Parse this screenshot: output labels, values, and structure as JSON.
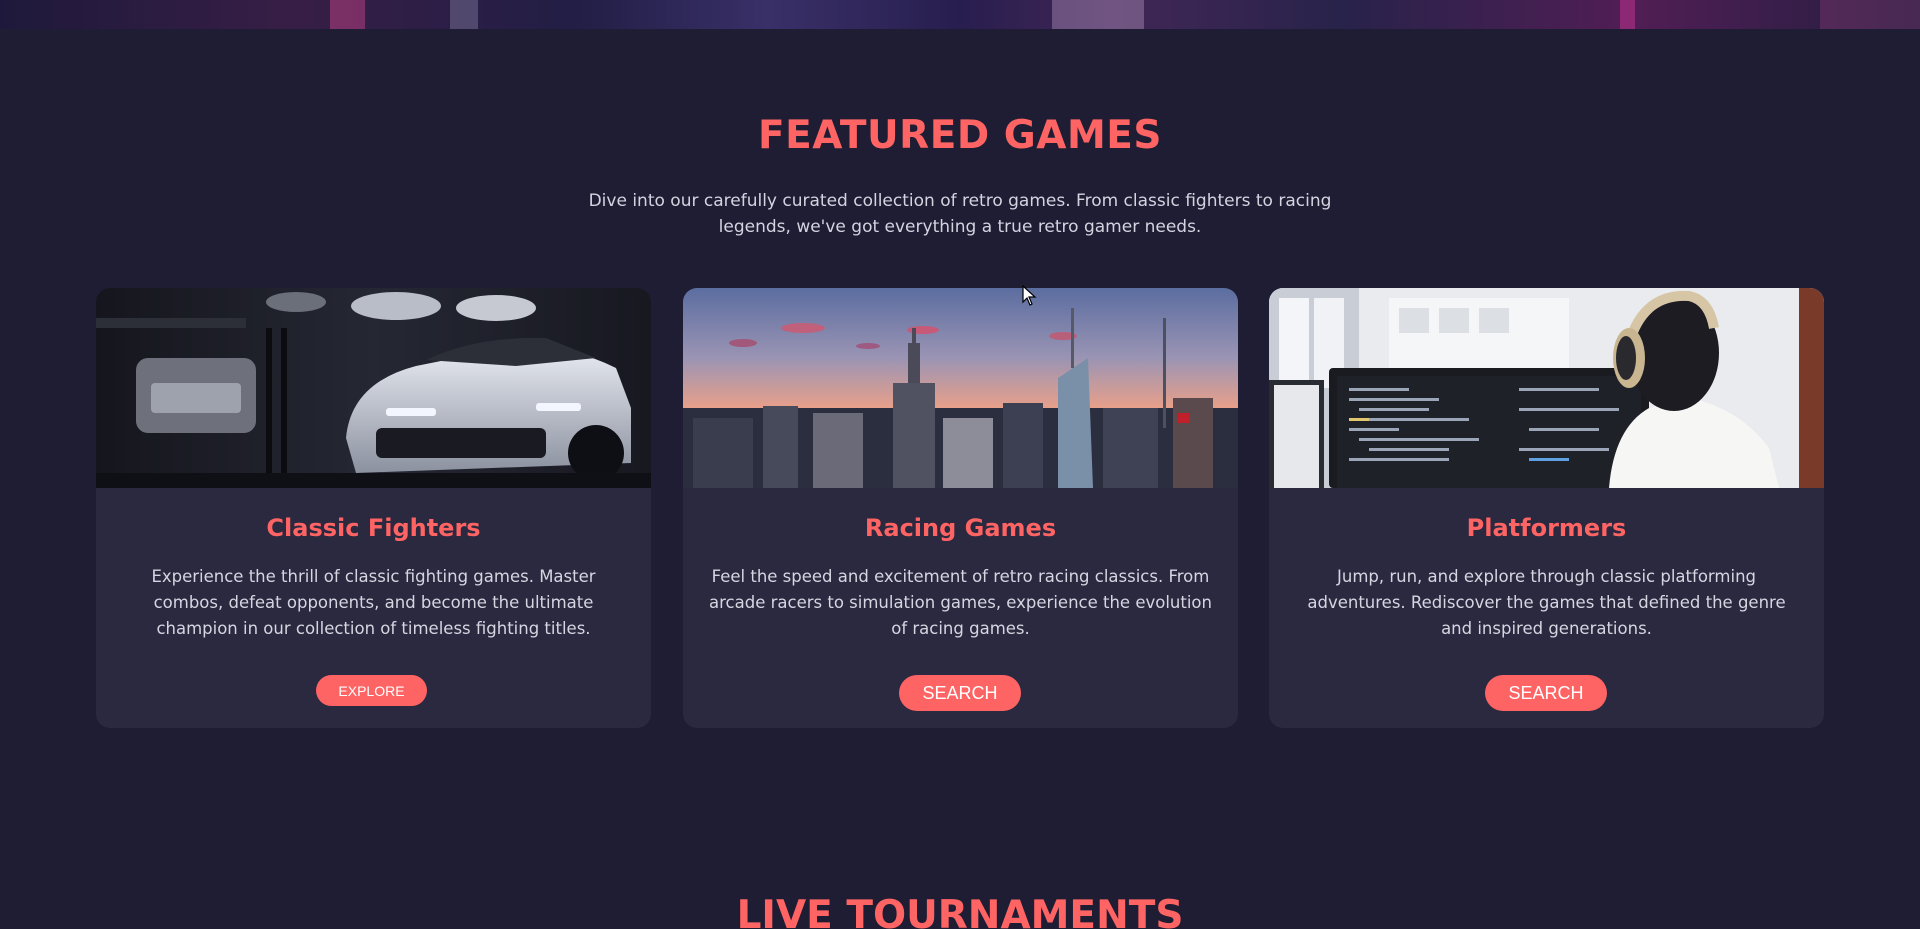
{
  "featured": {
    "title": "FEATURED GAMES",
    "description": "Dive into our carefully curated collection of retro games. From classic fighters to racing legends, we've got everything a true retro gamer needs."
  },
  "cards": [
    {
      "title": "Classic Fighters",
      "text": "Experience the thrill of classic fighting games. Master combos, defeat opponents, and become the ultimate champion in our collection of timeless fighting titles.",
      "button": "EXPLORE",
      "image": "sports-car-garage-photo"
    },
    {
      "title": "Racing Games",
      "text": "Feel the speed and excitement of retro racing classics. From arcade racers to simulation games, experience the evolution of racing games.",
      "button": "SEARCH",
      "image": "city-skyline-sunset-photo"
    },
    {
      "title": "Platformers",
      "text": "Jump, run, and explore through classic platforming adventures. Rediscover the games that defined the genre and inspired generations.",
      "button": "SEARCH",
      "image": "developer-with-headphones-photo"
    }
  ],
  "tournaments": {
    "title": "LIVE TOURNAMENTS"
  },
  "colors": {
    "background": "#1e1d33",
    "card": "#2a293f",
    "accent": "#ff6464",
    "text": "#d6d5e1"
  }
}
